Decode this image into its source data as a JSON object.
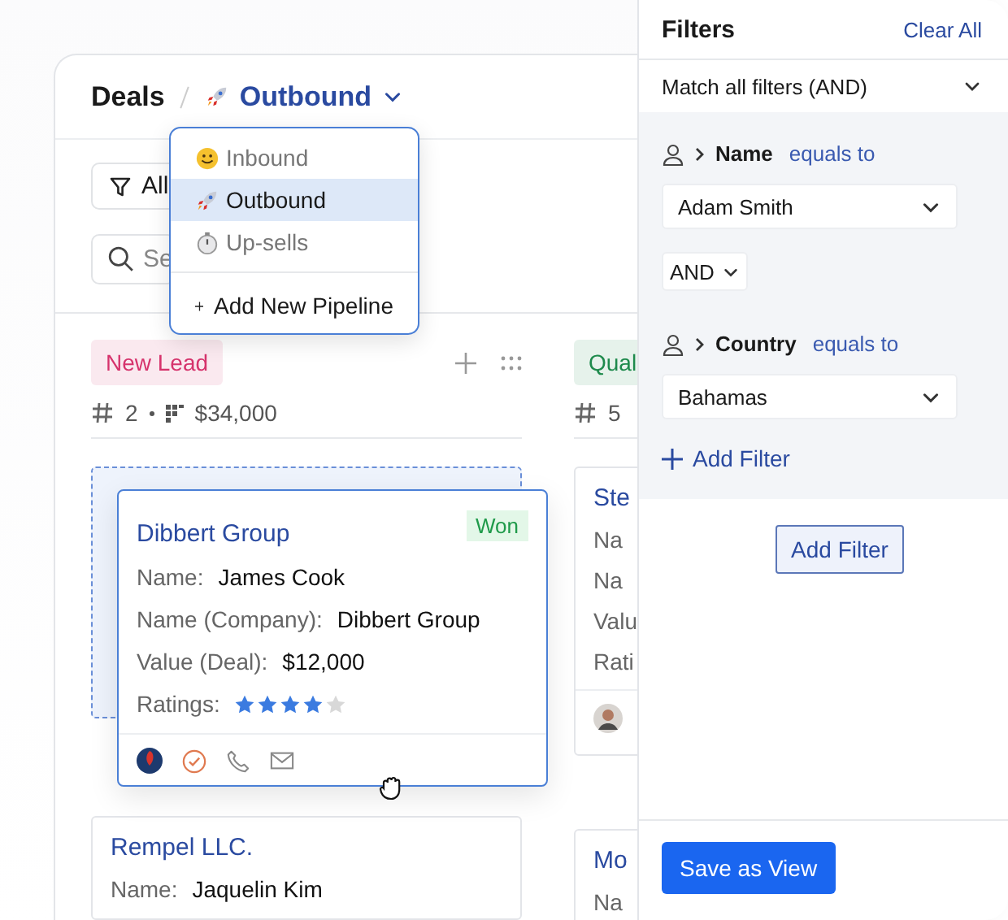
{
  "header": {
    "title": "Deals",
    "pipeline": "Outbound"
  },
  "pipeline_menu": {
    "items": [
      {
        "label": "Inbound",
        "selected": false
      },
      {
        "label": "Outbound",
        "selected": true
      },
      {
        "label": "Up-sells",
        "selected": false
      }
    ],
    "add": "Add New Pipeline"
  },
  "toolbar": {
    "filter_button": "All",
    "search": {
      "placeholder": "Se"
    }
  },
  "columns": [
    {
      "tag": "New Lead",
      "color": "#d6336c",
      "count": "2",
      "amount": "$34,000",
      "cards": [
        {
          "kind": "placeholder"
        },
        {
          "kind": "card",
          "title": "Rempel LLC.",
          "fields": [
            {
              "label": "Name:",
              "value": "Jaquelin Kim"
            }
          ]
        }
      ]
    },
    {
      "tag": "Qual",
      "color": "#1e8a4c",
      "count": "5",
      "cards": [
        {
          "kind": "card",
          "title": "Ste",
          "fields": [
            {
              "label": "Na"
            },
            {
              "label": "Na"
            },
            {
              "label": "Valu"
            },
            {
              "label": "Rati"
            }
          ],
          "avatar": true
        },
        {
          "kind": "card",
          "title": "Mo",
          "fields": [
            {
              "label": "Na"
            }
          ]
        }
      ]
    }
  ],
  "dragged_card": {
    "title": "Dibbert Group",
    "status": "Won",
    "fields": [
      {
        "label": "Name:",
        "value": "James Cook"
      },
      {
        "label": "Name (Company):",
        "value": "Dibbert Group"
      },
      {
        "label": "Value (Deal):",
        "value": "$12,000"
      }
    ],
    "ratings_label": "Ratings:",
    "stars": 4
  },
  "filters": {
    "title": "Filters",
    "clear": "Clear All",
    "match": "Match all filters (AND)",
    "items": [
      {
        "kind": "condition",
        "field": "Name",
        "operator": "equals to",
        "value": "Adam Smith"
      },
      {
        "kind": "joiner",
        "value": "AND"
      },
      {
        "kind": "condition",
        "field": "Country",
        "operator": "equals to",
        "value": "Bahamas"
      }
    ],
    "add_link": "Add Filter",
    "add_button": "Add Filter",
    "save": "Save as View"
  }
}
